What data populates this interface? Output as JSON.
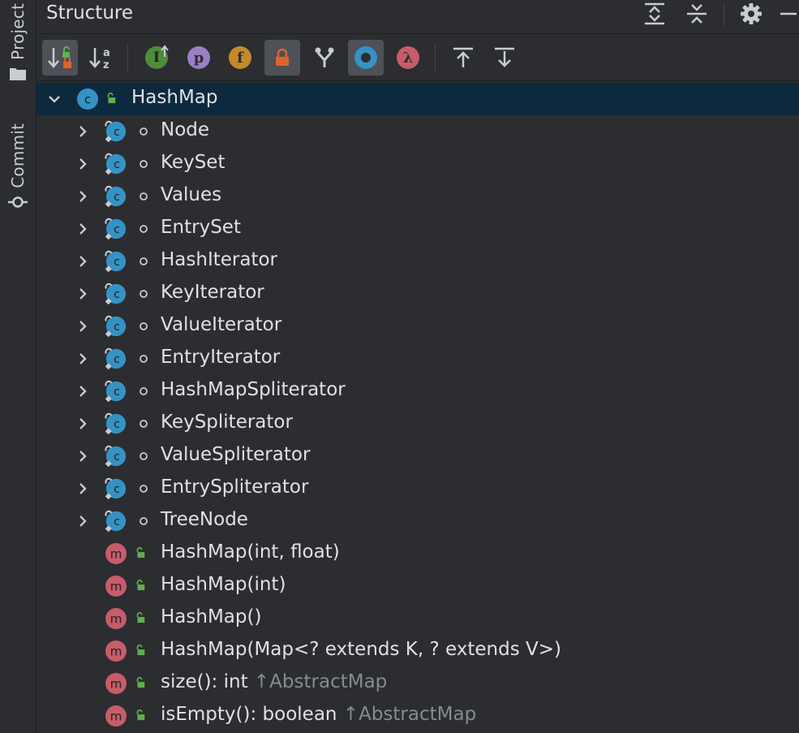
{
  "sidebar": {
    "project_label": "Project",
    "commit_label": "Commit"
  },
  "panel": {
    "title": "Structure"
  },
  "colors": {
    "class_badge": "#3592c4",
    "method_badge": "#c75c6b",
    "interface_badge": "#4f8c3a",
    "property_badge": "#9a7fc7",
    "field_badge": "#c48a2a",
    "lambda_badge": "#c75c6b",
    "lock_orange": "#e0632b",
    "unlock_green": "#5fb04b",
    "selection": "#0d293e"
  },
  "toolbar": {
    "icons": [
      "sort-by-visibility-icon",
      "sort-alphabetically-icon",
      "show-inherited-icon",
      "show-properties-icon",
      "show-fields-icon",
      "show-non-public-icon",
      "show-inheritance-icon",
      "show-anonymous-icon",
      "show-lambdas-icon",
      "navigate-up-icon",
      "navigate-down-icon"
    ]
  },
  "tree": {
    "root": {
      "name": "HashMap",
      "kind": "class",
      "badge": "c"
    },
    "classes": [
      {
        "name": "Node",
        "badge": "c"
      },
      {
        "name": "KeySet",
        "badge": "c"
      },
      {
        "name": "Values",
        "badge": "c"
      },
      {
        "name": "EntrySet",
        "badge": "c"
      },
      {
        "name": "HashIterator",
        "badge": "c"
      },
      {
        "name": "KeyIterator",
        "badge": "c"
      },
      {
        "name": "ValueIterator",
        "badge": "c"
      },
      {
        "name": "EntryIterator",
        "badge": "c"
      },
      {
        "name": "HashMapSpliterator",
        "badge": "c"
      },
      {
        "name": "KeySpliterator",
        "badge": "c"
      },
      {
        "name": "ValueSpliterator",
        "badge": "c"
      },
      {
        "name": "EntrySpliterator",
        "badge": "c"
      },
      {
        "name": "TreeNode",
        "badge": "c"
      }
    ],
    "methods": [
      {
        "name": "HashMap(int, float)",
        "badge": "m",
        "inherited": ""
      },
      {
        "name": "HashMap(int)",
        "badge": "m",
        "inherited": ""
      },
      {
        "name": "HashMap()",
        "badge": "m",
        "inherited": ""
      },
      {
        "name": "HashMap(Map<? extends K, ? extends V>)",
        "badge": "m",
        "inherited": ""
      },
      {
        "name": "size(): int",
        "badge": "m",
        "inherited": "↑AbstractMap"
      },
      {
        "name": "isEmpty(): boolean",
        "badge": "m",
        "inherited": "↑AbstractMap"
      }
    ]
  }
}
